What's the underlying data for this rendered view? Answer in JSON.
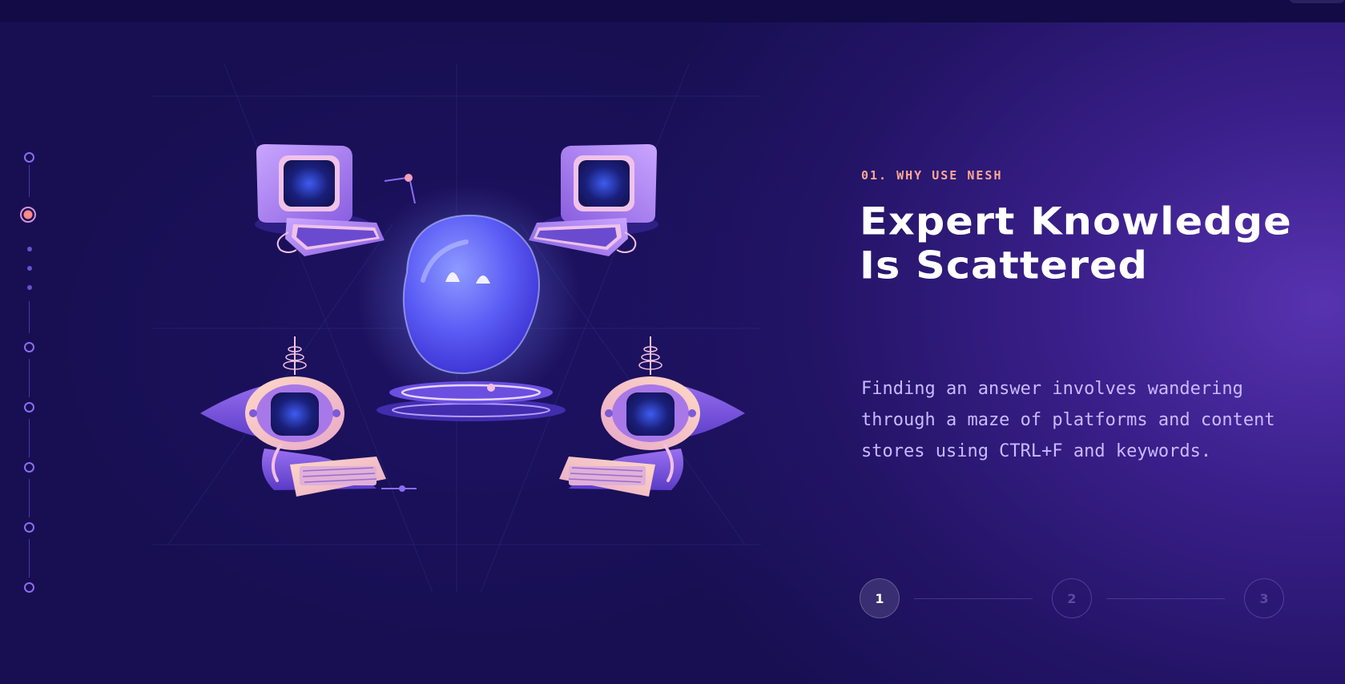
{
  "section": {
    "eyebrow": "01. WHY USE NESH",
    "headline": "Expert Knowledge Is Scattered",
    "body": "Finding an answer involves wandering through a maze of platforms and content stores using CTRL+F and keywords."
  },
  "stepper": {
    "steps": [
      "1",
      "2",
      "3"
    ],
    "active_step": "1"
  },
  "side_nav": {
    "active_index": 1,
    "item_count": 7
  },
  "colors": {
    "background": "#170f52",
    "accent_eyebrow": "#ffa892",
    "body_text": "#c9b9ff",
    "headline": "#ffffff",
    "nav_ring": "#8c6cf2",
    "nav_active": "#ff8a86"
  },
  "illustration": {
    "description_icon": "blob-and-computers-illustration"
  }
}
